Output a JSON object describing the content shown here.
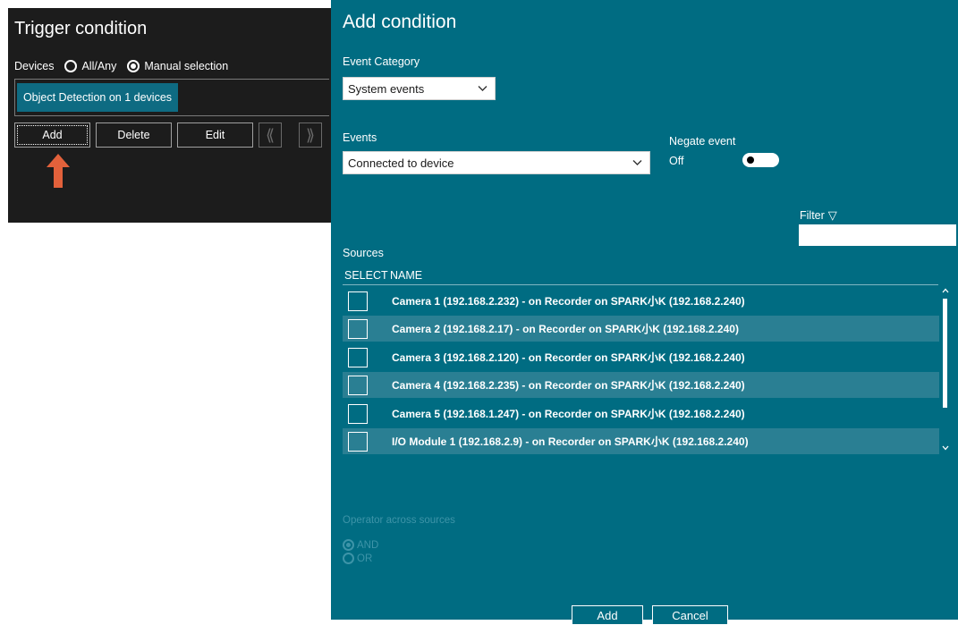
{
  "trigger": {
    "title": "Trigger condition",
    "devices_label": "Devices",
    "radio_all": "All/Any",
    "radio_manual": "Manual selection",
    "selected_chip": "Object Detection on 1 devices",
    "buttons": {
      "add": "Add",
      "delete": "Delete",
      "edit": "Edit"
    },
    "nav": {
      "prev": "⟪",
      "next": "⟫"
    }
  },
  "dialog": {
    "title": "Add condition",
    "event_category_label": "Event Category",
    "event_category_value": "System events",
    "events_label": "Events",
    "events_value": "Connected to device",
    "negate_label": "Negate event",
    "negate_state": "Off",
    "filter_label": "Filter",
    "filter_icon": "▽",
    "sources_label": "Sources",
    "columns": {
      "select": "SELECT",
      "name": "NAME"
    },
    "sources": [
      "Camera 1 (192.168.2.232) - on Recorder on SPARK小K (192.168.2.240)",
      "Camera 2 (192.168.2.17) - on Recorder on SPARK小K (192.168.2.240)",
      "Camera 3 (192.168.2.120) - on Recorder on SPARK小K (192.168.2.240)",
      "Camera 4 (192.168.2.235) - on Recorder on SPARK小K (192.168.2.240)",
      "Camera 5 (192.168.1.247) - on Recorder on SPARK小K (192.168.2.240)",
      "I/O Module 1 (192.168.2.9) - on Recorder on SPARK小K (192.168.2.240)"
    ],
    "operator_label": "Operator across sources",
    "op_and": "AND",
    "op_or": "OR",
    "add_button": "Add",
    "cancel_button": "Cancel",
    "chevron": "⌵"
  },
  "colors": {
    "dialog_bg": "#006c82",
    "left_bg": "#1c1c1c",
    "chip_bg": "#0e6b82",
    "arrow": "#e2613b",
    "row_alt": "#2a7f93"
  }
}
